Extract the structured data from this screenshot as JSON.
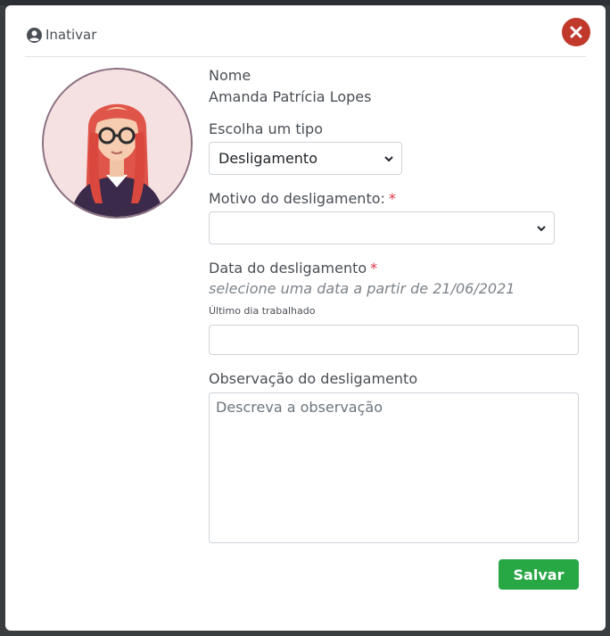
{
  "header": {
    "title": "Inativar",
    "title_icon": "user-circle-icon",
    "close_icon": "close-icon",
    "close_color": "#c0392b"
  },
  "profile": {
    "name_label": "Nome",
    "name_value": "Amanda Patrícia Lopes"
  },
  "form": {
    "type_label": "Escolha um tipo",
    "type_selected": "Desligamento",
    "reason_label": "Motivo do desligamento:",
    "reason_selected": "",
    "required_mark": "*",
    "date_label": "Data do desligamento",
    "date_hint": "selecione uma data a partir de 21/06/2021",
    "last_day_label": "Último dia trabalhado",
    "last_day_value": "",
    "note_label": "Observação do desligamento",
    "note_placeholder": "Descreva a observação"
  },
  "actions": {
    "save_label": "Salvar",
    "save_color": "#28a745"
  }
}
